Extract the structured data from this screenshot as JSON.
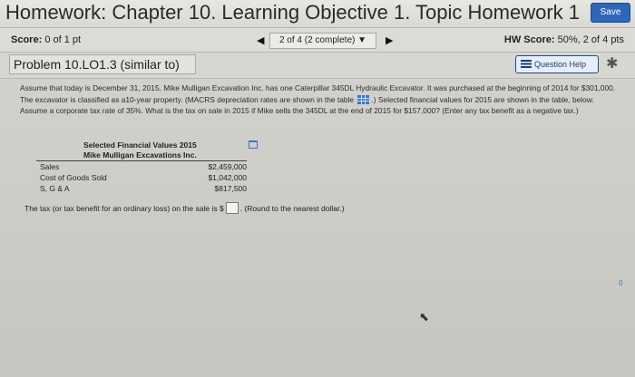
{
  "header": {
    "title": "Homework: Chapter 10. Learning Objective 1. Topic Homework 1",
    "save_label": "Save"
  },
  "score_bar": {
    "score_label": "Score:",
    "score_value": "0 of 1 pt",
    "nav_text": "2 of 4 (2 complete) ▼",
    "hw_score_label": "HW Score:",
    "hw_score_value": "50%, 2 of 4 pts"
  },
  "problem": {
    "title": "Problem 10.LO1.3 (similar to)",
    "help_label": "Question Help"
  },
  "question": {
    "text_part1": "Assume that today is December 31, 2015. Mike Mulligan Excavation Inc. has one Caterpillar 345DL Hydraulic Excavator. It was purchased at the beginning of 2014 for $301,000. The excavator is classified as a10-year property. (MACRS depreciation rates are shown in the table",
    "text_part2": ".) Selected financial values for 2015 are shown in the table, below. Assume a corporate tax rate of 35%. What is the tax on sale in 2015 if Mike sells the 345DL at the end of 2015 for $157,000? (Enter any tax benefit as a negative tax.)"
  },
  "financials": {
    "title_line1": "Selected Financial Values 2015",
    "title_line2": "Mike Mulligan Excavations Inc.",
    "rows": [
      {
        "label": "Sales",
        "value": "$2,459,000"
      },
      {
        "label": "Cost of Goods Sold",
        "value": "$1,042,000"
      },
      {
        "label": "S, G & A",
        "value": "$817,500"
      }
    ]
  },
  "answer": {
    "prefix": "The tax (or tax benefit for an ordinary loss) on the sale is $",
    "suffix": ". (Round to the nearest dollar.)"
  },
  "side_marker": "0"
}
